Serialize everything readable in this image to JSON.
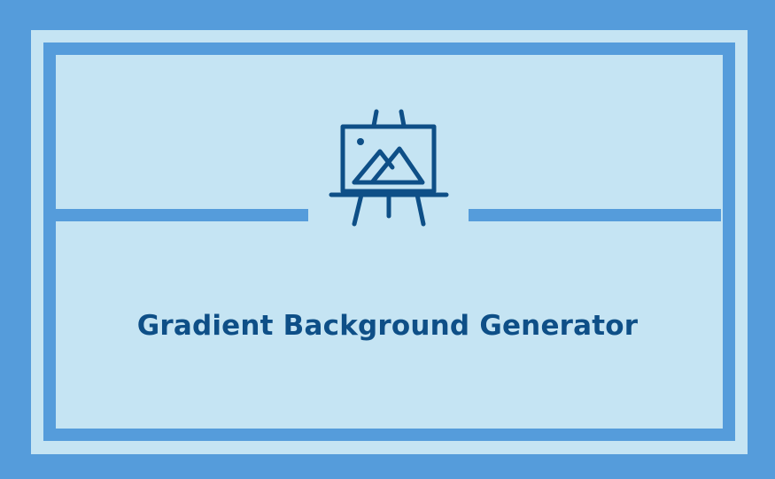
{
  "card": {
    "title": "Gradient Background Generator",
    "icon": "easel-picture-icon"
  },
  "colors": {
    "border": "#559cdb",
    "panel": "#c5e4f3",
    "text": "#0e4f87"
  }
}
